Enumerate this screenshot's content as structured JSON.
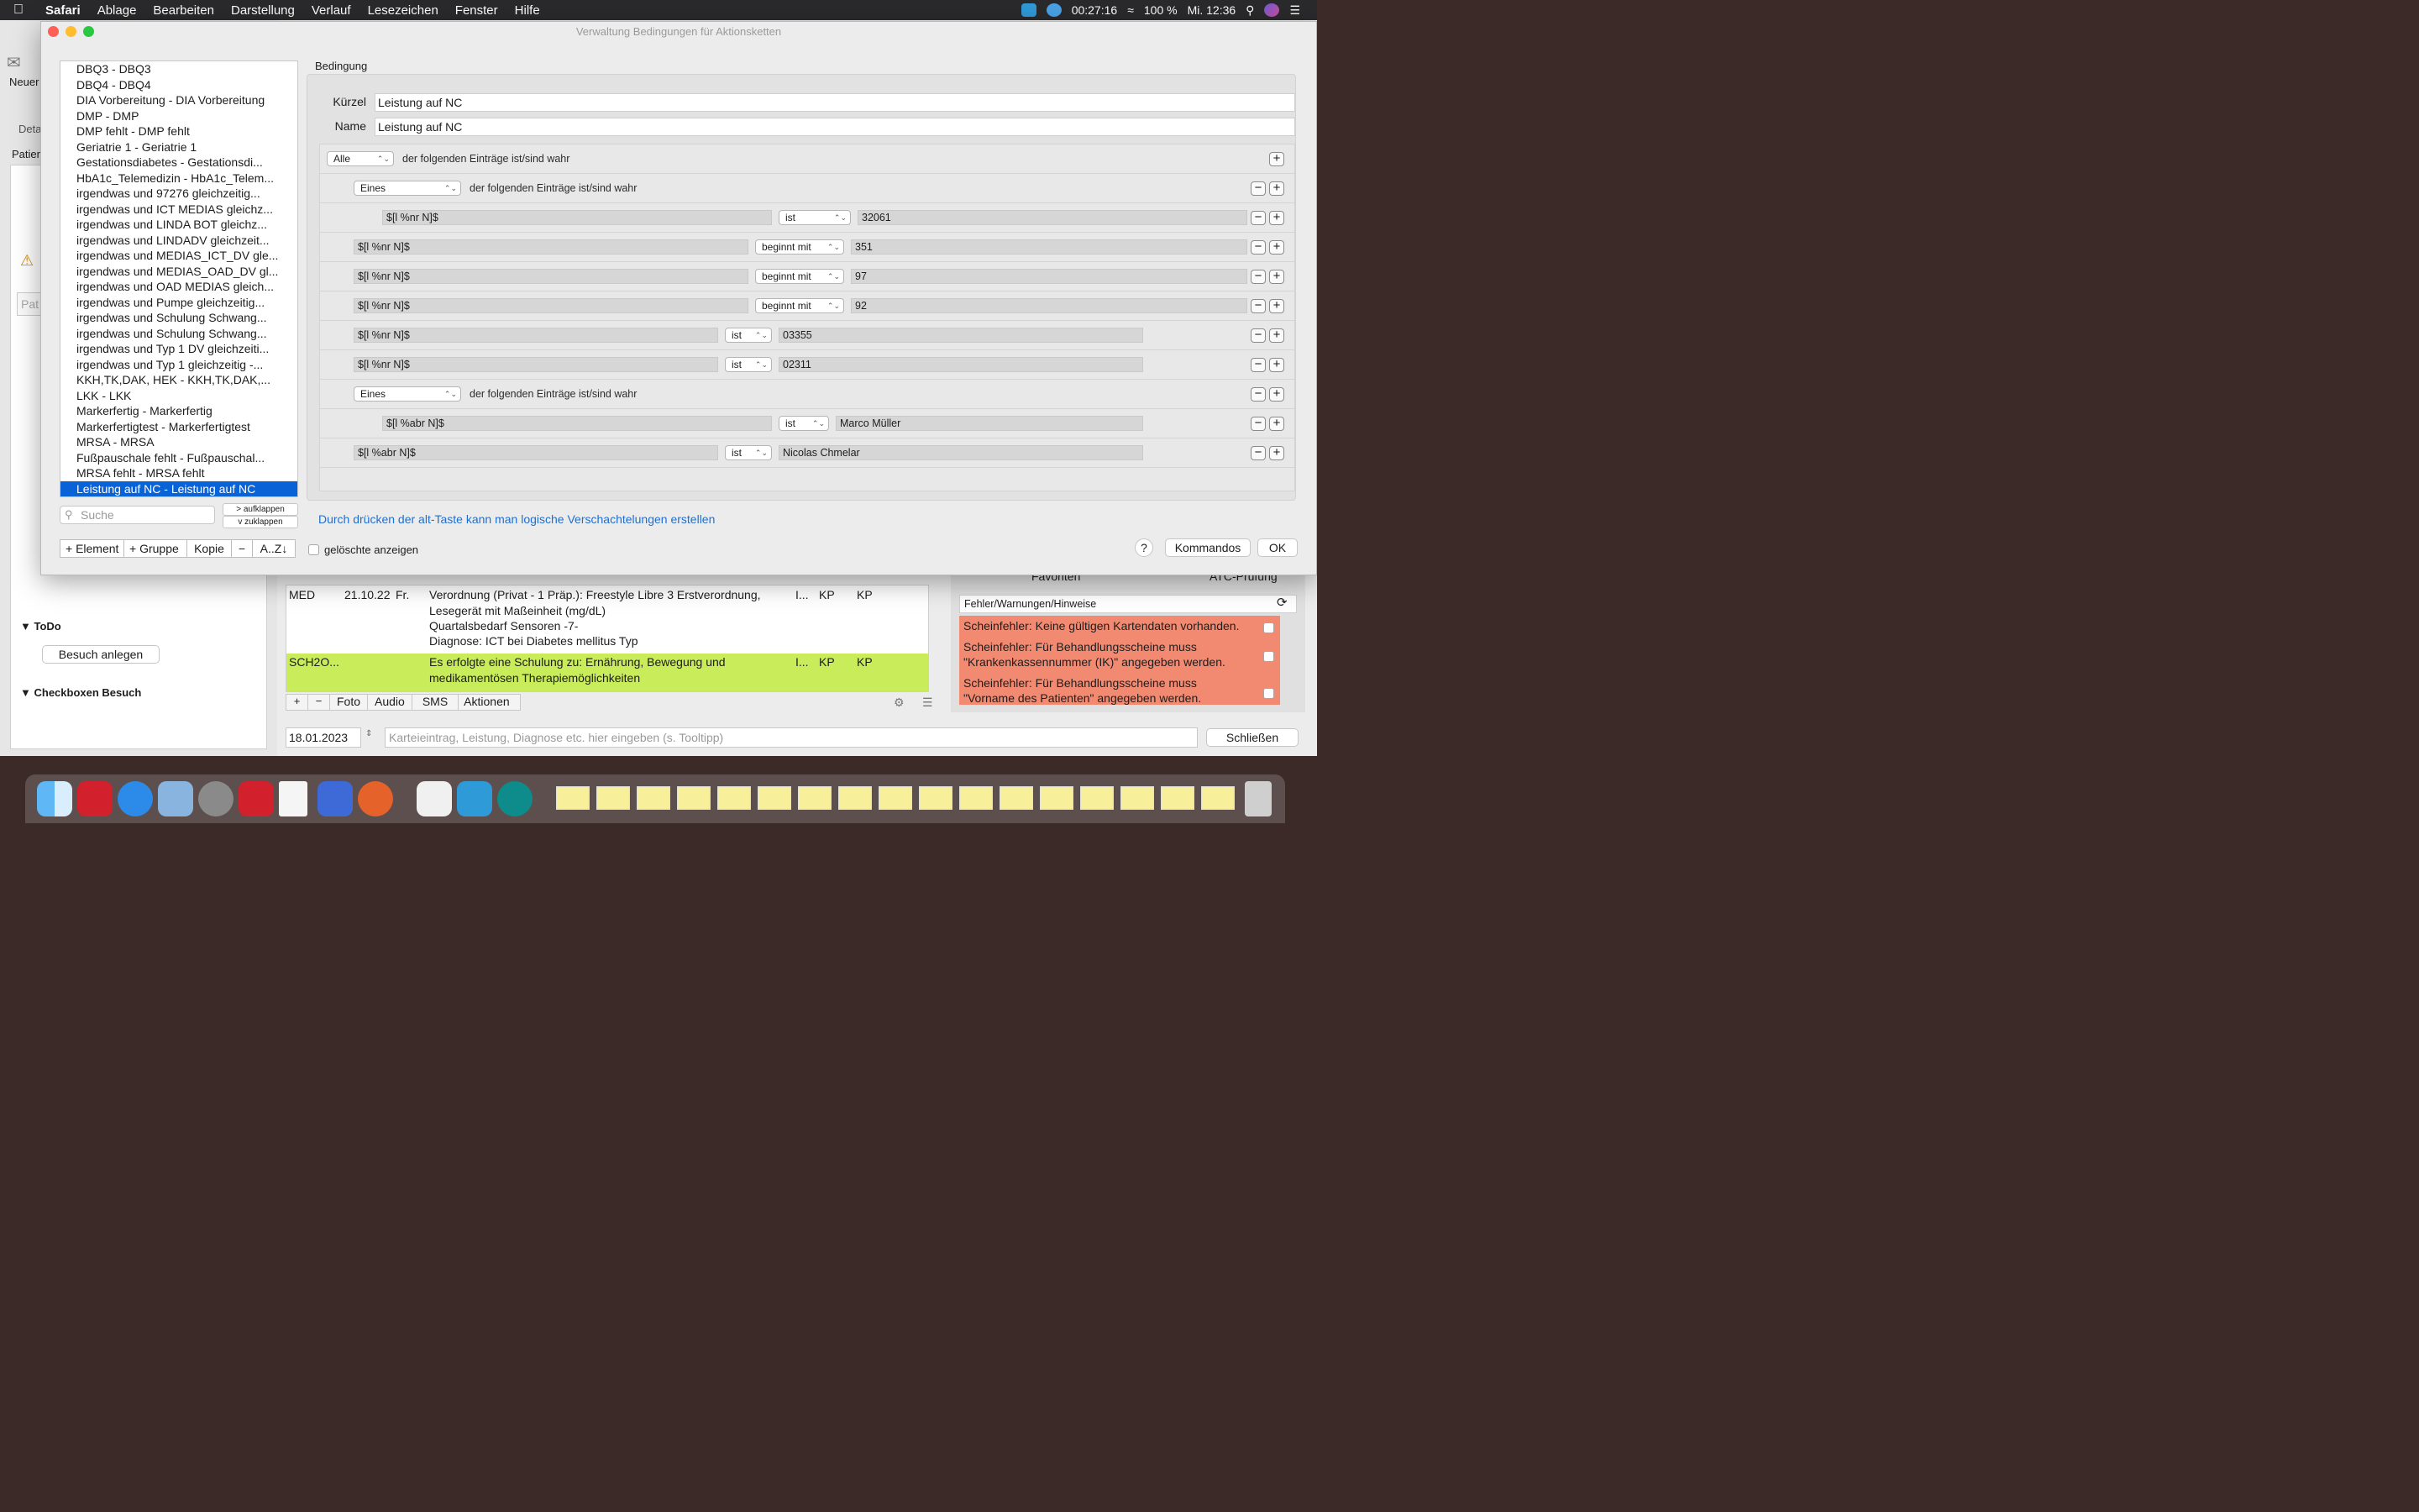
{
  "menubar": {
    "app": "Safari",
    "items": [
      "Ablage",
      "Bearbeiten",
      "Darstellung",
      "Verlauf",
      "Lesezeichen",
      "Fenster",
      "Hilfe"
    ],
    "battery_time": "00:27:16",
    "battery_pct": "100 %",
    "clock": "Mi. 12:36"
  },
  "background_app": {
    "toolbar_new": "Neuer",
    "toolbar_details": "Deta",
    "patient_label": "Patien",
    "patient_field": "Pat",
    "todo_header": "ToDo",
    "visit_button": "Besuch anlegen",
    "checkbox_header": "Checkboxen Besuch",
    "table_rows": [
      {
        "type": "MED",
        "date": "21.10.22",
        "day": "Fr.",
        "text_lines": [
          "Verordnung (Privat - 1 Präp.): Freestyle Libre 3 Erstverordnung,",
          "Lesegerät mit Maßeinheit (mg/dL)",
          "Quartalsbedarf Sensoren -7-",
          "Diagnose: ICT bei Diabetes mellitus Typ"
        ],
        "c1": "I...",
        "c2": "KP",
        "c3": "KP"
      },
      {
        "type": "SCH2O...",
        "date": "",
        "day": "",
        "text_lines": [
          "Es erfolgte eine Schulung zu: Ernährung,  Bewegung und",
          "medikamentösen Therapiemöglichkeiten"
        ],
        "c1": "I...",
        "c2": "KP",
        "c3": "KP"
      }
    ],
    "entry_tabs": [
      "Foto",
      "Audio",
      "SMS",
      "Aktionen"
    ],
    "date_field": "18.01.2023",
    "entry_placeholder": "Karteieintrag, Leistung, Diagnose etc. hier eingeben (s. Tooltipp)",
    "close_button": "Schließen",
    "right_tabs": [
      "Favoriten",
      "ATC-Prüfung"
    ],
    "warnings_header": "Fehler/Warnungen/Hinweise",
    "warnings": [
      [
        "Scheinfehler: Keine gültigen Kartendaten vorhanden."
      ],
      [
        "Scheinfehler: Für Behandlungsscheine muss",
        "\"Krankenkassennummer (IK)\" angegeben werden."
      ],
      [
        "Scheinfehler: Für Behandlungsscheine muss",
        "\"Vorname des Patienten\" angegeben werden."
      ]
    ]
  },
  "dialog": {
    "title": "Verwaltung Bedingungen für Aktionsketten",
    "list_items": [
      "DBQ3 - DBQ3",
      "DBQ4 - DBQ4",
      "DIA Vorbereitung - DIA Vorbereitung",
      "DMP - DMP",
      "DMP fehlt - DMP fehlt",
      "Geriatrie 1 - Geriatrie 1",
      "Gestationsdiabetes - Gestationsdi...",
      "HbA1c_Telemedizin - HbA1c_Telem...",
      "irgendwas und 97276 gleichzeitig...",
      "irgendwas und ICT MEDIAS gleichz...",
      "irgendwas und LINDA BOT gleichz...",
      "irgendwas und LINDADV gleichzeit...",
      "irgendwas und MEDIAS_ICT_DV gle...",
      "irgendwas und MEDIAS_OAD_DV gl...",
      "irgendwas und OAD MEDIAS gleich...",
      "irgendwas und Pumpe gleichzeitig...",
      "irgendwas und Schulung Schwang...",
      "irgendwas und Schulung Schwang...",
      "irgendwas und Typ 1 DV gleichzeiti...",
      "irgendwas und Typ 1 gleichzeitig  -...",
      "KKH,TK,DAK, HEK - KKH,TK,DAK,...",
      "LKK - LKK",
      "Markerfertig - Markerfertig",
      "Markerfertigtest - Markerfertigtest",
      "MRSA - MRSA",
      "Fußpauschale fehlt - Fußpauschal...",
      "MRSA fehlt - MRSA fehlt",
      "Leistung auf NC - Leistung auf NC"
    ],
    "selected_index": 27,
    "search_placeholder": "Suche",
    "expand_label": "> aufklappen",
    "collapse_label": "v  zuklappen",
    "bottom_buttons": [
      "+ Element",
      "+ Gruppe",
      "Kopie",
      "−",
      "A..Z↓"
    ],
    "show_deleted": "gelöschte anzeigen",
    "group_label": "Bedingung",
    "kuerzel_label": "Kürzel",
    "kuerzel_value": "Leistung auf NC",
    "name_label": "Name",
    "name_value": "Leistung auf NC",
    "following_text": "der folgenden Einträge ist/sind wahr",
    "rules": [
      {
        "kind": "group",
        "level": 0,
        "quant": "Alle"
      },
      {
        "kind": "group",
        "level": 1,
        "quant": "Eines"
      },
      {
        "kind": "cond",
        "level": 2,
        "field": "$[l %nr N]$",
        "op": "ist",
        "value": "32061"
      },
      {
        "kind": "cond",
        "level": 1,
        "field": "$[l %nr N]$",
        "op": "beginnt mit",
        "value": "351"
      },
      {
        "kind": "cond",
        "level": 1,
        "field": "$[l %nr N]$",
        "op": "beginnt mit",
        "value": "97"
      },
      {
        "kind": "cond",
        "level": 1,
        "field": "$[l %nr N]$",
        "op": "beginnt mit",
        "value": "92"
      },
      {
        "kind": "cond",
        "level": 1,
        "field": "$[l %nr N]$",
        "op": "ist",
        "value": "03355"
      },
      {
        "kind": "cond",
        "level": 1,
        "field": "$[l %nr N]$",
        "op": "ist",
        "value": "02311"
      },
      {
        "kind": "group",
        "level": 1,
        "quant": "Eines"
      },
      {
        "kind": "cond",
        "level": 2,
        "field": "$[l %abr N]$",
        "op": "ist",
        "value": "Marco Müller"
      },
      {
        "kind": "cond",
        "level": 1,
        "field": "$[l %abr N]$",
        "op": "ist",
        "value": "Nicolas Chmelar"
      }
    ],
    "hint": "Durch drücken der alt-Taste kann man logische Verschachtelungen erstellen",
    "help": "?",
    "commands": "Kommandos",
    "ok": "OK"
  },
  "colors": {
    "selection": "#0a63d6",
    "hint": "#1f6fd0",
    "warning_bg": "#f28a72",
    "highlight_row": "#c9ec5a"
  }
}
